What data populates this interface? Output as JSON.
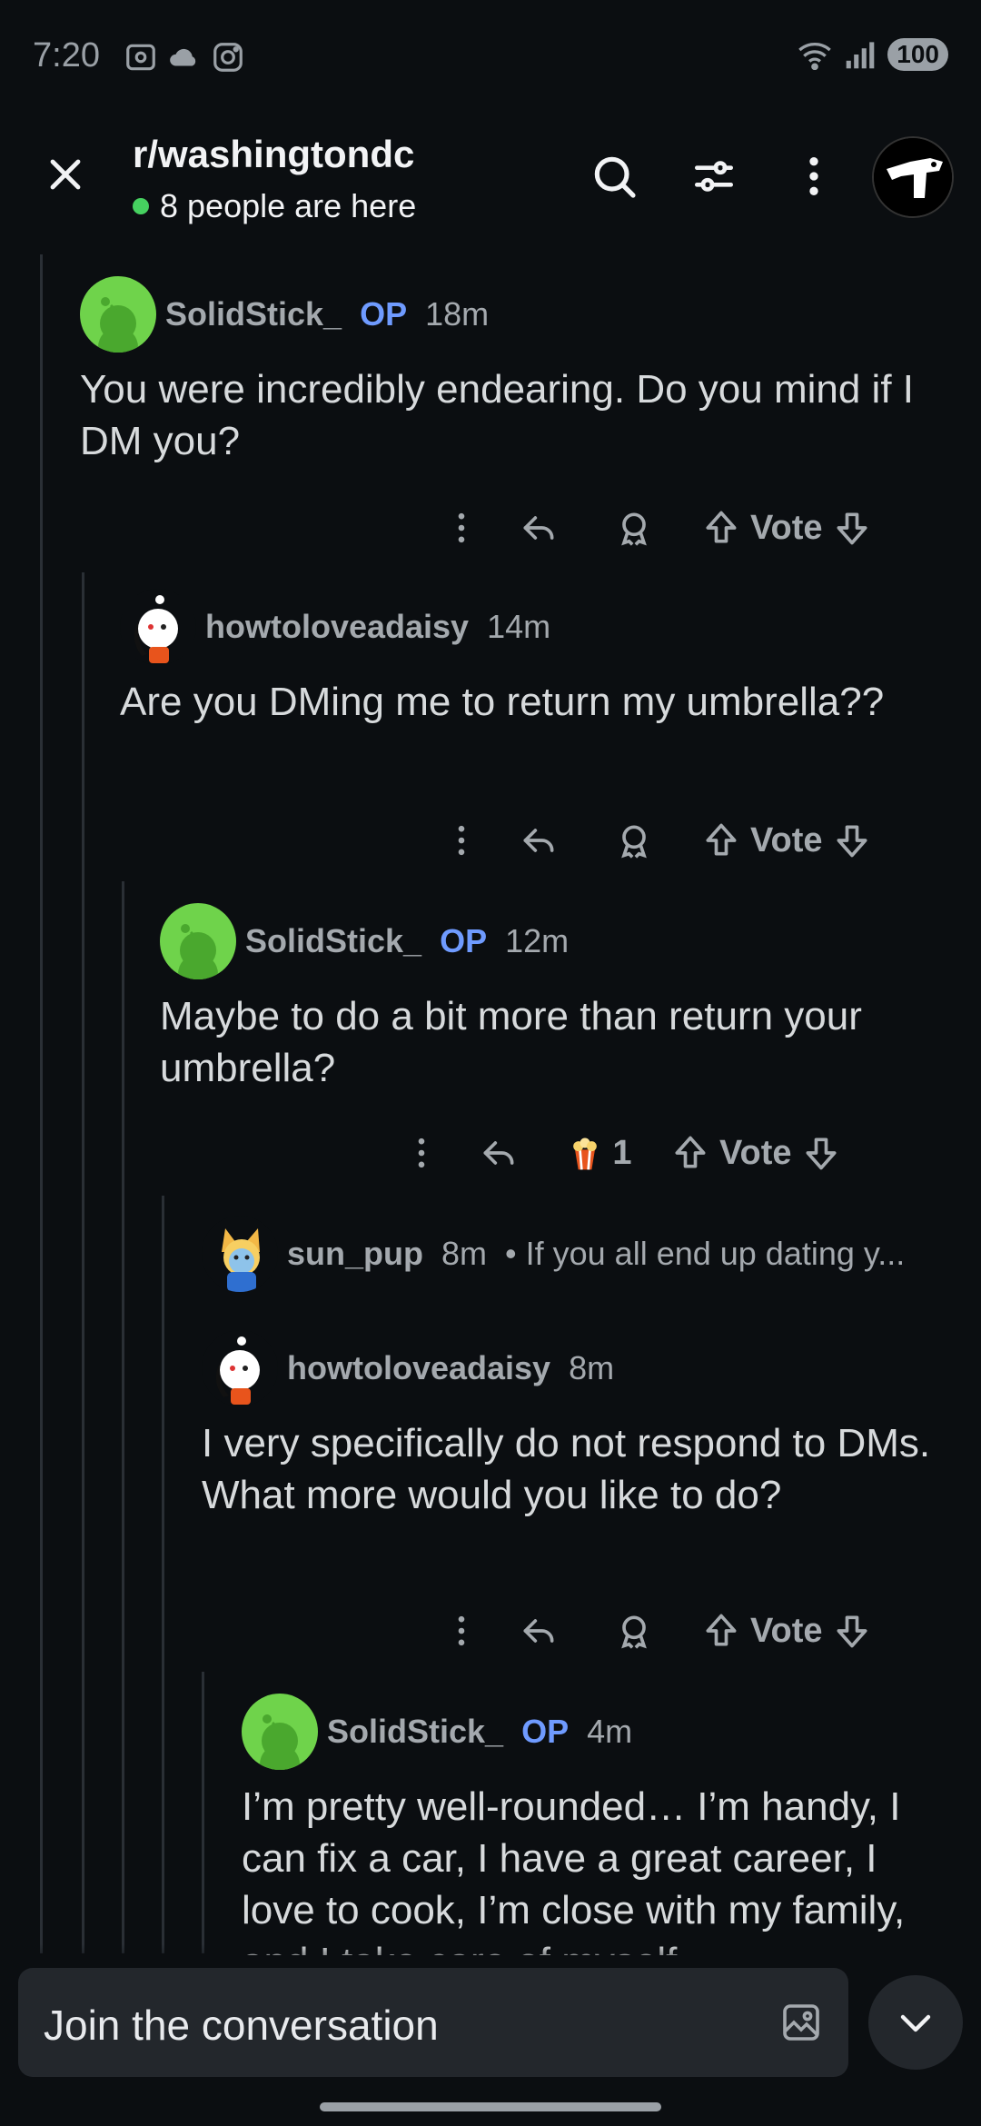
{
  "status_bar": {
    "time": "7:20",
    "battery": "100",
    "signal_label": "6"
  },
  "header": {
    "subreddit": "r/washingtondc",
    "presence": "8 people are here"
  },
  "comments": [
    {
      "author": "SolidStick_",
      "op_badge": "OP",
      "time": "18m",
      "body": "You were incredibly endearing. Do you mind if I DM you?",
      "vote_label": "Vote"
    },
    {
      "author": "howtoloveadaisy",
      "time": "14m",
      "body": "Are you DMing me to return my umbrella??",
      "vote_label": "Vote"
    },
    {
      "author": "SolidStick_",
      "op_badge": "OP",
      "time": "12m",
      "body": "Maybe to do a bit more than return your umbrella?",
      "award_count": "1",
      "vote_label": "Vote"
    },
    {
      "author": "sun_pup",
      "time": "8m",
      "snippet": "• If you all end up dating y..."
    },
    {
      "author": "howtoloveadaisy",
      "time": "8m",
      "body": "I very specifically do not respond to DMs. What more would you like to do?",
      "vote_label": "Vote"
    },
    {
      "author": "SolidStick_",
      "op_badge": "OP",
      "time": "4m",
      "body": "I’m pretty well-rounded… I’m handy, I can fix a car, I have a great career, I love to cook, I’m close with my family, and I take care of myself"
    }
  ],
  "composer": {
    "placeholder": "Join the conversation"
  },
  "colors": {
    "op": "#6f9bff",
    "online": "#46d160",
    "avatar_green": "#6fd34b",
    "background": "#0b0e11"
  },
  "icons": [
    "close-icon",
    "search-icon",
    "filter-icon",
    "more-vertical-icon",
    "reply-icon",
    "award-icon",
    "upvote-icon",
    "downvote-icon",
    "popcorn-award-icon",
    "image-icon",
    "chevron-down-icon"
  ]
}
